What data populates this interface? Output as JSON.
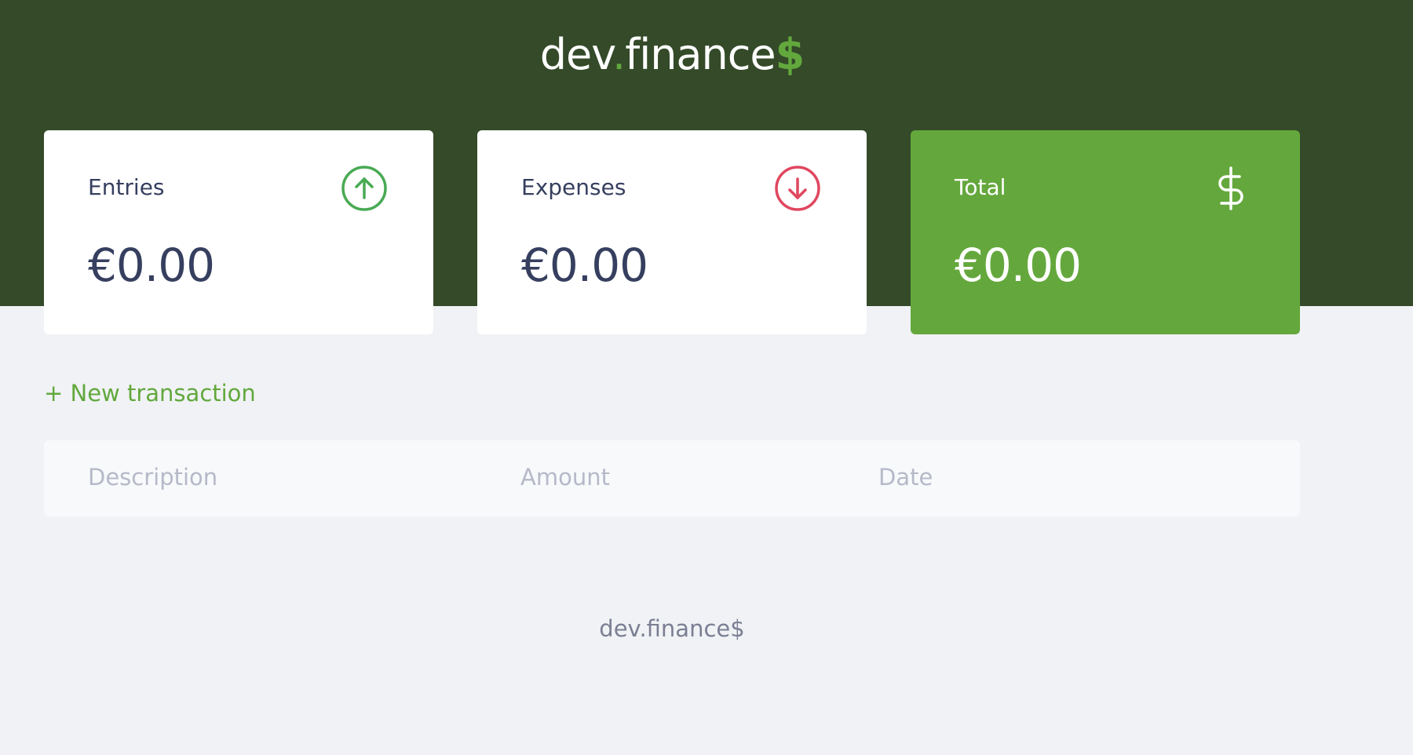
{
  "header": {
    "logo_part1": "dev",
    "logo_dot": ".",
    "logo_part2": "finance",
    "logo_dollar": "$"
  },
  "cards": {
    "entries": {
      "label": "Entries",
      "value": "€0.00",
      "icon": "arrow-up-circle-icon",
      "icon_color": "#49aa54"
    },
    "expenses": {
      "label": "Expenses",
      "value": "€0.00",
      "icon": "arrow-down-circle-icon",
      "icon_color": "#e0475f"
    },
    "total": {
      "label": "Total",
      "value": "€0.00",
      "icon": "dollar-sign-icon",
      "icon_color": "#ffffff"
    }
  },
  "actions": {
    "new_transaction": "+ New transaction"
  },
  "table": {
    "columns": [
      "Description",
      "Amount",
      "Date"
    ]
  },
  "footer": {
    "text": "dev.finance$"
  },
  "colors": {
    "header_bg": "#344a29",
    "accent": "#62a83d",
    "total_card": "#64a83d",
    "page_bg": "#f0f2f5",
    "text_dark": "#363f5f"
  }
}
